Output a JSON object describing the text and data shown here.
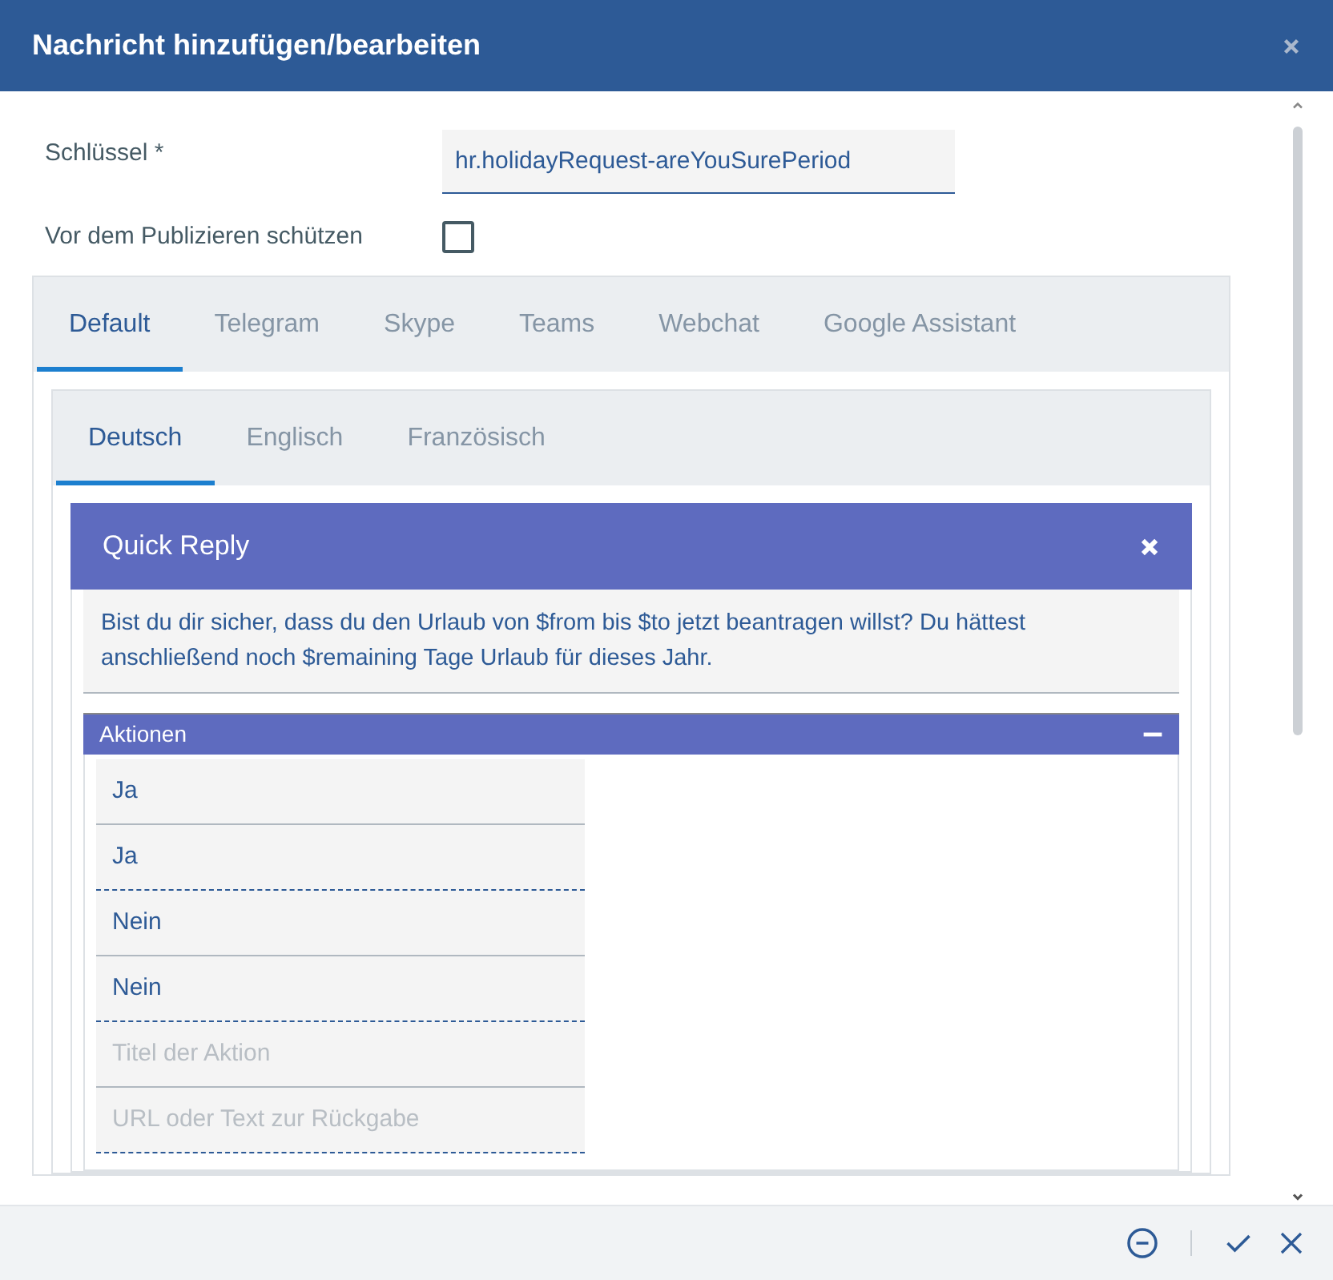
{
  "dialog": {
    "title": "Nachricht hinzufügen/bearbeiten"
  },
  "key_field": {
    "label": "Schlüssel *",
    "value": "hr.holidayRequest-areYouSurePeriod"
  },
  "protect": {
    "label": "Vor dem Publizieren schützen",
    "checked": false
  },
  "channel_tabs": [
    {
      "label": "Default",
      "selected": true
    },
    {
      "label": "Telegram",
      "selected": false
    },
    {
      "label": "Skype",
      "selected": false
    },
    {
      "label": "Teams",
      "selected": false
    },
    {
      "label": "Webchat",
      "selected": false
    },
    {
      "label": "Google Assistant",
      "selected": false
    }
  ],
  "language_tabs": [
    {
      "label": "Deutsch",
      "selected": true
    },
    {
      "label": "Englisch",
      "selected": false
    },
    {
      "label": "Französisch",
      "selected": false
    }
  ],
  "quick_reply": {
    "title": "Quick Reply",
    "text": "Bist du dir sicher, dass du den Urlaub von $from bis $to jetzt beantragen willst? Du hättest anschließend noch $remaining Tage Urlaub für dieses Jahr.",
    "actions_title": "Aktionen",
    "actions": [
      {
        "title": {
          "value": "Ja"
        },
        "payload": {
          "value": "Ja"
        }
      },
      {
        "title": {
          "value": "Nein"
        },
        "payload": {
          "value": "Nein"
        }
      },
      {
        "title": {
          "placeholder": "Titel der Aktion"
        },
        "payload": {
          "placeholder": "URL oder Text zur Rückgabe"
        }
      }
    ]
  }
}
